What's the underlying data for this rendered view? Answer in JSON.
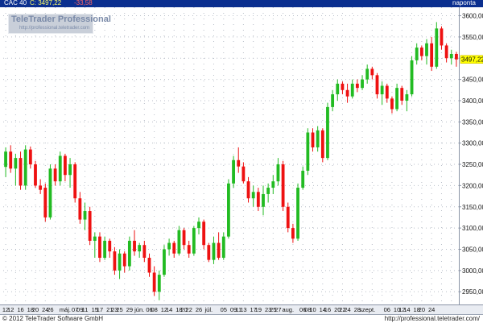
{
  "header": {
    "symbol": "CAC 40",
    "quote": "C: 3497,22",
    "change": "-33,58",
    "interval": "naponta"
  },
  "watermark": {
    "brand": "TeleTrader Professional",
    "url": "http://professional.teletrader.com"
  },
  "footer": {
    "copyright": "© 2012 TeleTrader Software GmbH",
    "url": "http://professional.teletrader.com/"
  },
  "colors": {
    "up": "#22bb22",
    "down": "#ee1111",
    "titlebar": "#0b2f8f",
    "grid": "#b8bec8",
    "last_price_marker": "#ffff00"
  },
  "chart_data": {
    "type": "candlestick",
    "title": "CAC 40",
    "ylim": [
      2920,
      3620
    ],
    "y_ticks": [
      "3600,00",
      "3550,00",
      "3500,00",
      "3450,00",
      "3400,00",
      "3350,00",
      "3300,00",
      "3250,00",
      "3200,00",
      "3150,00",
      "3100,00",
      "3050,00",
      "3000,00",
      "2950,00"
    ],
    "y_tick_values": [
      3600,
      3550,
      3500,
      3450,
      3400,
      3350,
      3300,
      3250,
      3200,
      3150,
      3100,
      3050,
      3000,
      2950
    ],
    "last_price": 3497.22,
    "last_price_label": "3497,22",
    "x_labels": [
      "12",
      "12",
      "16",
      "18",
      "20",
      "24",
      "26",
      "máj.",
      "07",
      "09",
      "11",
      "15",
      "17",
      "21",
      "23",
      "25",
      "29",
      "jún.",
      "06",
      "08",
      "12",
      "14",
      "18",
      "20",
      "22",
      "26",
      "júl.",
      "05",
      "09",
      "11",
      "13",
      "17",
      "19",
      "23",
      "25",
      "27",
      "aug.",
      "06",
      "08",
      "10",
      "14",
      "16",
      "20",
      "22",
      "24",
      "28",
      "szept.",
      "06",
      "10",
      "12",
      "14",
      "18",
      "20",
      "24"
    ],
    "x_label_index": [
      0,
      1,
      3,
      5,
      6,
      8,
      9,
      12,
      14,
      15,
      16,
      18,
      19,
      21,
      22,
      23,
      25,
      27,
      29,
      30,
      32,
      33,
      35,
      36,
      37,
      39,
      41,
      44,
      46,
      47,
      48,
      50,
      51,
      53,
      54,
      55,
      57,
      60,
      61,
      62,
      64,
      65,
      67,
      68,
      69,
      71,
      73,
      77,
      79,
      80,
      81,
      83,
      84,
      86
    ],
    "candles": [
      {
        "o": 3244,
        "h": 3290,
        "l": 3220,
        "c": 3280
      },
      {
        "o": 3280,
        "h": 3295,
        "l": 3230,
        "c": 3240
      },
      {
        "o": 3240,
        "h": 3275,
        "l": 3200,
        "c": 3265
      },
      {
        "o": 3265,
        "h": 3280,
        "l": 3190,
        "c": 3200
      },
      {
        "o": 3200,
        "h": 3295,
        "l": 3190,
        "c": 3285
      },
      {
        "o": 3285,
        "h": 3292,
        "l": 3240,
        "c": 3250
      },
      {
        "o": 3250,
        "h": 3258,
        "l": 3195,
        "c": 3200
      },
      {
        "o": 3200,
        "h": 3215,
        "l": 3180,
        "c": 3190
      },
      {
        "o": 3195,
        "h": 3205,
        "l": 3115,
        "c": 3125
      },
      {
        "o": 3125,
        "h": 3250,
        "l": 3120,
        "c": 3240
      },
      {
        "o": 3240,
        "h": 3250,
        "l": 3200,
        "c": 3210
      },
      {
        "o": 3210,
        "h": 3280,
        "l": 3200,
        "c": 3270
      },
      {
        "o": 3270,
        "h": 3275,
        "l": 3210,
        "c": 3225
      },
      {
        "o": 3225,
        "h": 3265,
        "l": 3195,
        "c": 3250
      },
      {
        "o": 3250,
        "h": 3255,
        "l": 3160,
        "c": 3170
      },
      {
        "o": 3170,
        "h": 3185,
        "l": 3110,
        "c": 3120
      },
      {
        "o": 3120,
        "h": 3160,
        "l": 3095,
        "c": 3140
      },
      {
        "o": 3140,
        "h": 3150,
        "l": 3060,
        "c": 3070
      },
      {
        "o": 3070,
        "h": 3090,
        "l": 3030,
        "c": 3080
      },
      {
        "o": 3080,
        "h": 3090,
        "l": 3020,
        "c": 3030
      },
      {
        "o": 3030,
        "h": 3080,
        "l": 3025,
        "c": 3070
      },
      {
        "o": 3070,
        "h": 3075,
        "l": 3030,
        "c": 3045
      },
      {
        "o": 3045,
        "h": 3055,
        "l": 2990,
        "c": 3000
      },
      {
        "o": 3000,
        "h": 3050,
        "l": 2980,
        "c": 3040
      },
      {
        "o": 3040,
        "h": 3045,
        "l": 2995,
        "c": 3010
      },
      {
        "o": 3010,
        "h": 3080,
        "l": 3000,
        "c": 3070
      },
      {
        "o": 3070,
        "h": 3095,
        "l": 3035,
        "c": 3045
      },
      {
        "o": 3045,
        "h": 3065,
        "l": 3030,
        "c": 3060
      },
      {
        "o": 3060,
        "h": 3070,
        "l": 3020,
        "c": 3030
      },
      {
        "o": 3030,
        "h": 3040,
        "l": 2985,
        "c": 2995
      },
      {
        "o": 2995,
        "h": 3010,
        "l": 2940,
        "c": 2950
      },
      {
        "o": 2950,
        "h": 3000,
        "l": 2930,
        "c": 2990
      },
      {
        "o": 2990,
        "h": 3060,
        "l": 2985,
        "c": 3050
      },
      {
        "o": 3050,
        "h": 3075,
        "l": 3035,
        "c": 3065
      },
      {
        "o": 3065,
        "h": 3070,
        "l": 3030,
        "c": 3040
      },
      {
        "o": 3040,
        "h": 3105,
        "l": 3035,
        "c": 3095
      },
      {
        "o": 3095,
        "h": 3100,
        "l": 3050,
        "c": 3060
      },
      {
        "o": 3060,
        "h": 3070,
        "l": 3030,
        "c": 3040
      },
      {
        "o": 3040,
        "h": 3105,
        "l": 3035,
        "c": 3100
      },
      {
        "o": 3100,
        "h": 3125,
        "l": 3085,
        "c": 3115
      },
      {
        "o": 3115,
        "h": 3120,
        "l": 3050,
        "c": 3060
      },
      {
        "o": 3060,
        "h": 3065,
        "l": 3020,
        "c": 3025
      },
      {
        "o": 3025,
        "h": 3080,
        "l": 3015,
        "c": 3065
      },
      {
        "o": 3065,
        "h": 3090,
        "l": 3025,
        "c": 3030
      },
      {
        "o": 3030,
        "h": 3090,
        "l": 3025,
        "c": 3080
      },
      {
        "o": 3080,
        "h": 3215,
        "l": 3075,
        "c": 3205
      },
      {
        "o": 3205,
        "h": 3270,
        "l": 3195,
        "c": 3260
      },
      {
        "o": 3260,
        "h": 3290,
        "l": 3230,
        "c": 3245
      },
      {
        "o": 3245,
        "h": 3255,
        "l": 3205,
        "c": 3210
      },
      {
        "o": 3210,
        "h": 3220,
        "l": 3160,
        "c": 3170
      },
      {
        "o": 3170,
        "h": 3200,
        "l": 3150,
        "c": 3185
      },
      {
        "o": 3185,
        "h": 3195,
        "l": 3140,
        "c": 3150
      },
      {
        "o": 3150,
        "h": 3200,
        "l": 3130,
        "c": 3180
      },
      {
        "o": 3180,
        "h": 3205,
        "l": 3160,
        "c": 3195
      },
      {
        "o": 3195,
        "h": 3225,
        "l": 3180,
        "c": 3210
      },
      {
        "o": 3210,
        "h": 3265,
        "l": 3200,
        "c": 3250
      },
      {
        "o": 3250,
        "h": 3258,
        "l": 3140,
        "c": 3150
      },
      {
        "o": 3150,
        "h": 3160,
        "l": 3090,
        "c": 3100
      },
      {
        "o": 3100,
        "h": 3110,
        "l": 3065,
        "c": 3075
      },
      {
        "o": 3075,
        "h": 3205,
        "l": 3070,
        "c": 3195
      },
      {
        "o": 3195,
        "h": 3245,
        "l": 3190,
        "c": 3235
      },
      {
        "o": 3235,
        "h": 3335,
        "l": 3225,
        "c": 3325
      },
      {
        "o": 3325,
        "h": 3335,
        "l": 3280,
        "c": 3290
      },
      {
        "o": 3290,
        "h": 3340,
        "l": 3280,
        "c": 3330
      },
      {
        "o": 3330,
        "h": 3335,
        "l": 3255,
        "c": 3265
      },
      {
        "o": 3265,
        "h": 3395,
        "l": 3260,
        "c": 3385
      },
      {
        "o": 3385,
        "h": 3425,
        "l": 3375,
        "c": 3415
      },
      {
        "o": 3415,
        "h": 3450,
        "l": 3400,
        "c": 3440
      },
      {
        "o": 3440,
        "h": 3445,
        "l": 3415,
        "c": 3425
      },
      {
        "o": 3425,
        "h": 3440,
        "l": 3395,
        "c": 3410
      },
      {
        "o": 3410,
        "h": 3450,
        "l": 3405,
        "c": 3440
      },
      {
        "o": 3440,
        "h": 3450,
        "l": 3420,
        "c": 3430
      },
      {
        "o": 3430,
        "h": 3460,
        "l": 3425,
        "c": 3450
      },
      {
        "o": 3450,
        "h": 3485,
        "l": 3440,
        "c": 3475
      },
      {
        "o": 3475,
        "h": 3480,
        "l": 3450,
        "c": 3460
      },
      {
        "o": 3460,
        "h": 3465,
        "l": 3405,
        "c": 3415
      },
      {
        "o": 3415,
        "h": 3445,
        "l": 3390,
        "c": 3435
      },
      {
        "o": 3435,
        "h": 3440,
        "l": 3395,
        "c": 3405
      },
      {
        "o": 3405,
        "h": 3410,
        "l": 3370,
        "c": 3380
      },
      {
        "o": 3380,
        "h": 3440,
        "l": 3375,
        "c": 3430
      },
      {
        "o": 3430,
        "h": 3435,
        "l": 3390,
        "c": 3400
      },
      {
        "o": 3400,
        "h": 3425,
        "l": 3375,
        "c": 3415
      },
      {
        "o": 3415,
        "h": 3505,
        "l": 3410,
        "c": 3495
      },
      {
        "o": 3495,
        "h": 3535,
        "l": 3485,
        "c": 3525
      },
      {
        "o": 3525,
        "h": 3530,
        "l": 3495,
        "c": 3505
      },
      {
        "o": 3505,
        "h": 3545,
        "l": 3485,
        "c": 3535
      },
      {
        "o": 3535,
        "h": 3550,
        "l": 3470,
        "c": 3480
      },
      {
        "o": 3480,
        "h": 3585,
        "l": 3475,
        "c": 3570
      },
      {
        "o": 3570,
        "h": 3575,
        "l": 3520,
        "c": 3530
      },
      {
        "o": 3530,
        "h": 3535,
        "l": 3490,
        "c": 3500
      },
      {
        "o": 3500,
        "h": 3520,
        "l": 3485,
        "c": 3510
      },
      {
        "o": 3510,
        "h": 3515,
        "l": 3480,
        "c": 3497.22
      }
    ]
  }
}
